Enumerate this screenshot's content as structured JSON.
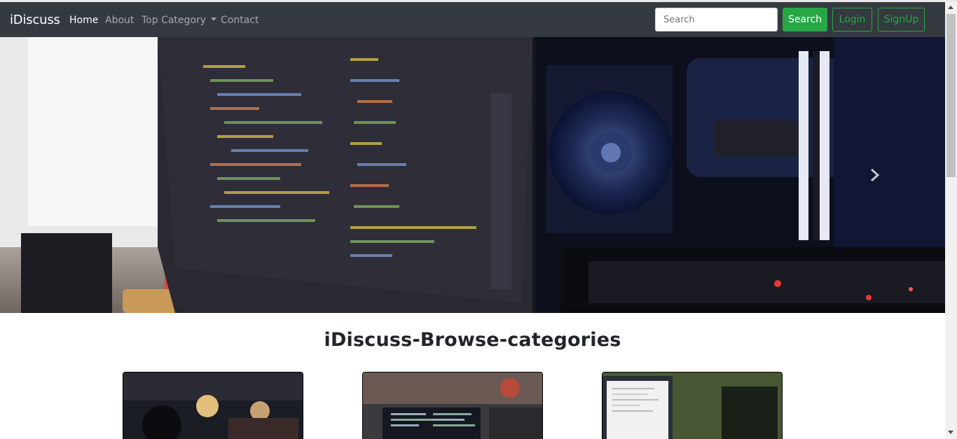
{
  "navbar": {
    "brand": "iDiscuss",
    "links": [
      {
        "label": "Home",
        "active": true
      },
      {
        "label": "About",
        "active": false
      },
      {
        "label": "Top Category",
        "active": false
      },
      {
        "label": "Contact",
        "active": false
      }
    ],
    "search": {
      "placeholder": "Search",
      "value": ""
    },
    "search_button": "Search",
    "login_button": "Login",
    "signup_button": "SignUp"
  },
  "carousel": {
    "slides": 3,
    "active_slide": 1,
    "next_icon": "chevron-right-icon"
  },
  "main": {
    "heading": "iDiscuss-Browse-categories"
  },
  "colors": {
    "navbar_bg": "#343a40",
    "success": "#28a745",
    "text": "#212529"
  }
}
